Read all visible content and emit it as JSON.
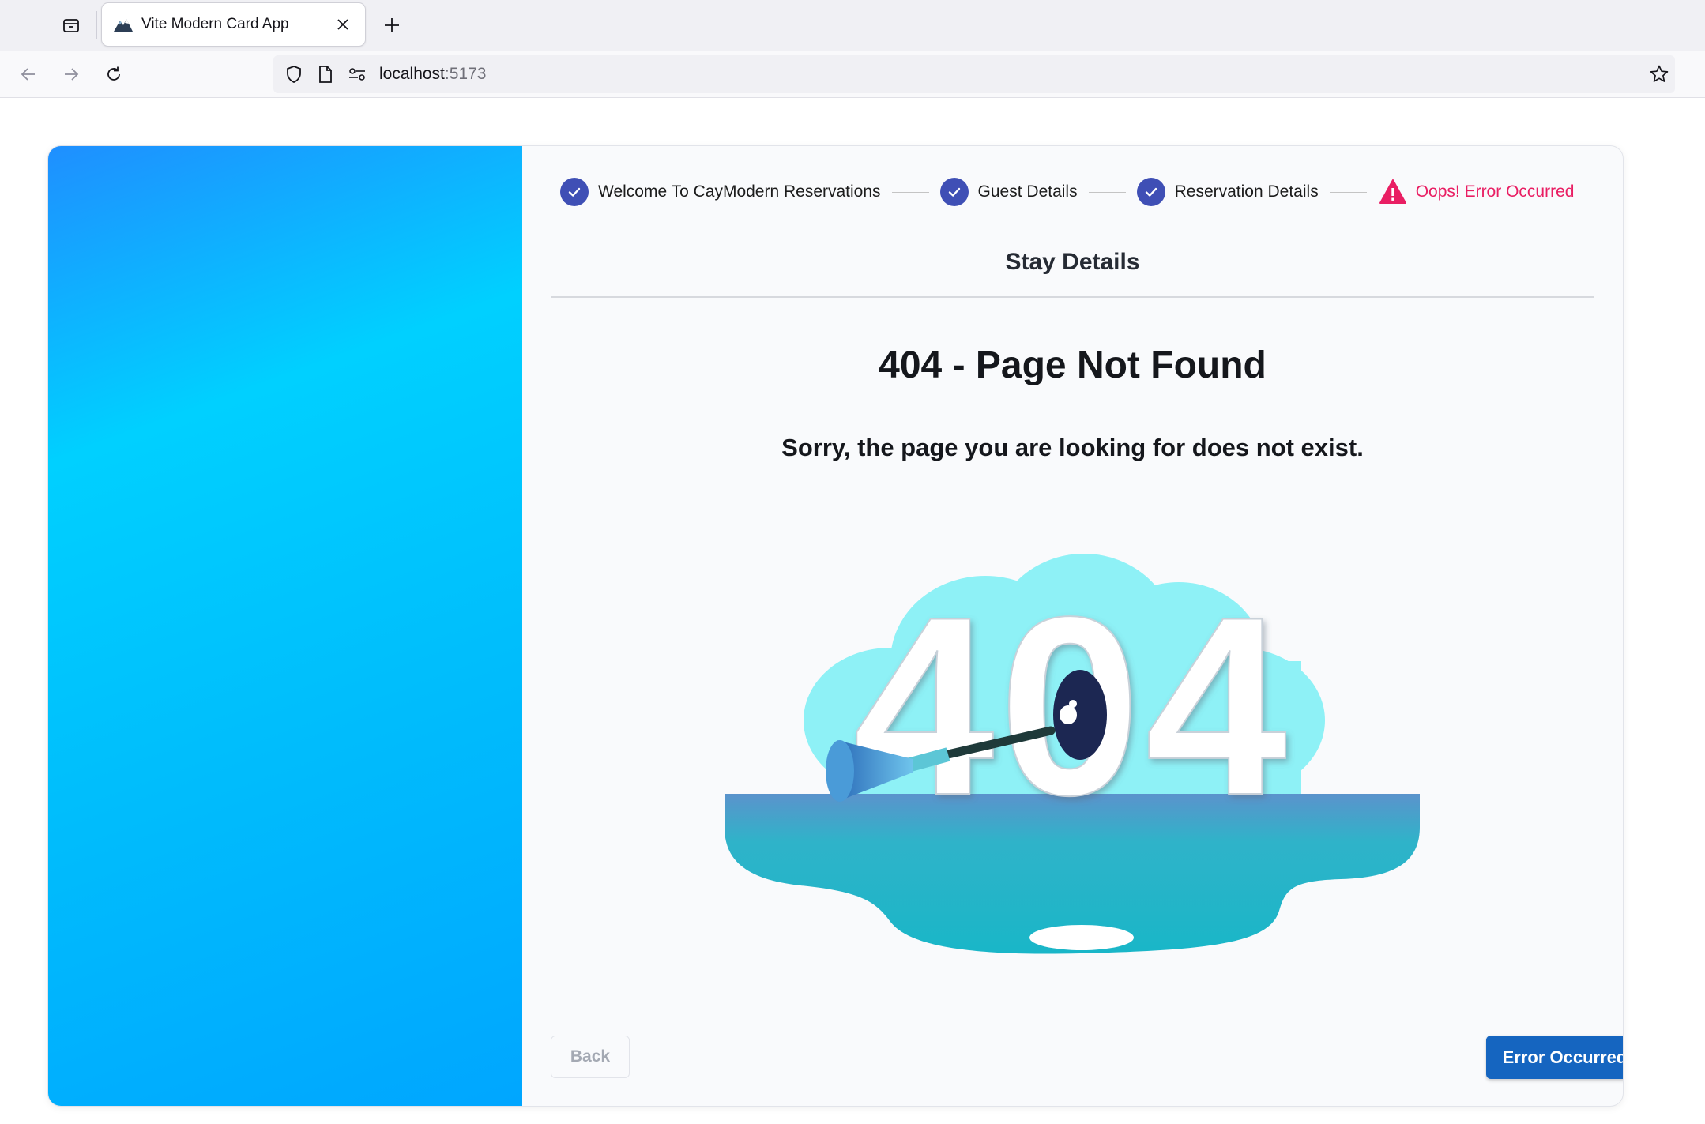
{
  "browser": {
    "tab_title": "Vite Modern Card App",
    "url_host": "localhost",
    "url_port": ":5173"
  },
  "stepper": {
    "steps": [
      {
        "label": "Welcome To CayModern Reservations",
        "status": "completed"
      },
      {
        "label": "Guest Details",
        "status": "completed"
      },
      {
        "label": "Reservation Details",
        "status": "completed"
      },
      {
        "label": "Oops! Error Occurred",
        "status": "error"
      }
    ]
  },
  "main": {
    "section_title": "Stay Details",
    "error_heading": "404 - Page Not Found",
    "error_message": "Sorry, the page you are looking for does not exist.",
    "illustration_text": "404"
  },
  "actions": {
    "back_label": "Back",
    "primary_label": "Error Occurred"
  },
  "colors": {
    "step_complete": "#3f4fb5",
    "step_error": "#e91e63",
    "primary_button": "#1565c0",
    "side_panel_start": "#1f8fff",
    "side_panel_end": "#00a6ff"
  }
}
